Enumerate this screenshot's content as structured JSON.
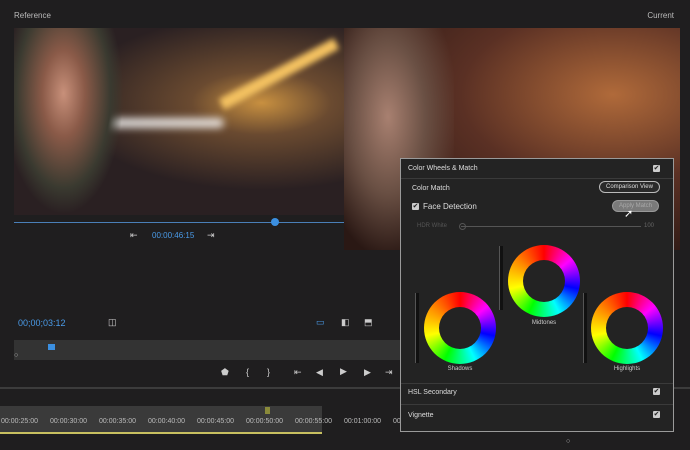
{
  "header": {
    "reference_label": "Reference",
    "current_label": "Current"
  },
  "reference": {
    "timecode": "00:00:46:15",
    "scrub_progress": 0.79
  },
  "program": {
    "timecode": "00;00;03:12"
  },
  "timeline": {
    "ticks": [
      "00:00:25:00",
      "00:00:30:00",
      "00:00:35:00",
      "00:00:40:00",
      "00:00:45:00",
      "00:00:50:00",
      "00:00:55:00",
      "00:01:00:00",
      "00:01:05:00"
    ]
  },
  "panel": {
    "title": "Color Wheels & Match",
    "title_checked": true,
    "color_match": "Color Match",
    "comparison_view": "Comparison View",
    "face_detection": "Face Detection",
    "face_detection_checked": true,
    "apply_match": "Apply Match",
    "hdr_white": "HDR White",
    "hdr_value": "100",
    "wheels": {
      "shadows": "Shadows",
      "midtones": "Midtones",
      "highlights": "Highlights"
    },
    "hsl_secondary": "HSL Secondary",
    "vignette": "Vignette"
  },
  "icons": {
    "check": "✔",
    "play": "▶"
  }
}
